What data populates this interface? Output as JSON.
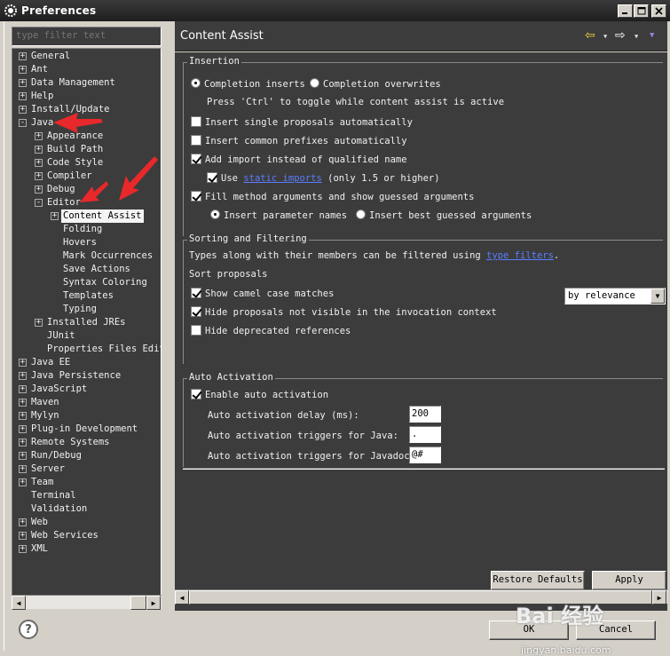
{
  "window": {
    "title": "Preferences"
  },
  "filter": {
    "placeholder": "type filter text"
  },
  "tree": [
    {
      "label": "General",
      "toggle": "+"
    },
    {
      "label": "Ant",
      "toggle": "+"
    },
    {
      "label": "Data Management",
      "toggle": "+"
    },
    {
      "label": "Help",
      "toggle": "+"
    },
    {
      "label": "Install/Update",
      "toggle": "+"
    },
    {
      "label": "Java",
      "toggle": "-"
    },
    {
      "label": "Appearance",
      "toggle": "+"
    },
    {
      "label": "Build Path",
      "toggle": "+"
    },
    {
      "label": "Code Style",
      "toggle": "+"
    },
    {
      "label": "Compiler",
      "toggle": "+"
    },
    {
      "label": "Debug",
      "toggle": "+"
    },
    {
      "label": "Editor",
      "toggle": "-"
    },
    {
      "label": "Content Assist",
      "toggle": "+"
    },
    {
      "label": "Folding",
      "toggle": ""
    },
    {
      "label": "Hovers",
      "toggle": ""
    },
    {
      "label": "Mark Occurrences",
      "toggle": ""
    },
    {
      "label": "Save Actions",
      "toggle": ""
    },
    {
      "label": "Syntax Coloring",
      "toggle": ""
    },
    {
      "label": "Templates",
      "toggle": ""
    },
    {
      "label": "Typing",
      "toggle": ""
    },
    {
      "label": "Installed JREs",
      "toggle": "+"
    },
    {
      "label": "JUnit",
      "toggle": ""
    },
    {
      "label": "Properties Files Edit",
      "toggle": ""
    },
    {
      "label": "Java EE",
      "toggle": "+"
    },
    {
      "label": "Java Persistence",
      "toggle": "+"
    },
    {
      "label": "JavaScript",
      "toggle": "+"
    },
    {
      "label": "Maven",
      "toggle": "+"
    },
    {
      "label": "Mylyn",
      "toggle": "+"
    },
    {
      "label": "Plug-in Development",
      "toggle": "+"
    },
    {
      "label": "Remote Systems",
      "toggle": "+"
    },
    {
      "label": "Run/Debug",
      "toggle": "+"
    },
    {
      "label": "Server",
      "toggle": "+"
    },
    {
      "label": "Team",
      "toggle": "+"
    },
    {
      "label": "Terminal",
      "toggle": ""
    },
    {
      "label": "Validation",
      "toggle": ""
    },
    {
      "label": "Web",
      "toggle": "+"
    },
    {
      "label": "Web Services",
      "toggle": "+"
    },
    {
      "label": "XML",
      "toggle": "+"
    }
  ],
  "page": {
    "title": "Content Assist"
  },
  "insertion": {
    "title": "Insertion",
    "completion_inserts": "Completion inserts",
    "completion_overwrites": "Completion overwrites",
    "ctrl_hint": "Press 'Ctrl' to toggle while content assist is active",
    "single_proposals": "Insert single proposals automatically",
    "common_prefixes": "Insert common prefixes automatically",
    "add_import": "Add import instead of qualified name",
    "use_label": "Use",
    "static_imports_link": "static imports",
    "static_imports_suffix": "(only 1.5 or higher)",
    "fill_args": "Fill method arguments and show guessed arguments",
    "insert_param_names": "Insert parameter names",
    "insert_best_guessed": "Insert best guessed arguments"
  },
  "sorting": {
    "title": "Sorting and Filtering",
    "types_text": "Types along with their members can be filtered using",
    "type_filters_link": "type filters",
    "period": ".",
    "sort_label": "Sort proposals",
    "sort_value": "by relevance",
    "camel_case": "Show camel case matches",
    "hide_not_visible": "Hide proposals not visible in the invocation context",
    "hide_deprecated": "Hide deprecated references"
  },
  "auto": {
    "title": "Auto Activation",
    "enable": "Enable auto activation",
    "delay_label": "Auto activation delay (ms):",
    "delay_value": "200",
    "java_label": "Auto activation triggers for Java:",
    "java_value": ".",
    "javadoc_label": "Auto activation triggers for Javadoc:",
    "javadoc_value": "@#"
  },
  "buttons": {
    "restore": "Restore Defaults",
    "apply": "Apply",
    "ok": "OK",
    "cancel": "Cancel"
  },
  "watermark": {
    "brand": "Bai 经验",
    "sub": "jingyan.baidu.com"
  },
  "colors": {
    "dark_panel": "#3c3c3c",
    "chrome": "#d4d0c8",
    "link": "#5b7dff",
    "annotation_arrow": "#e8282a"
  }
}
